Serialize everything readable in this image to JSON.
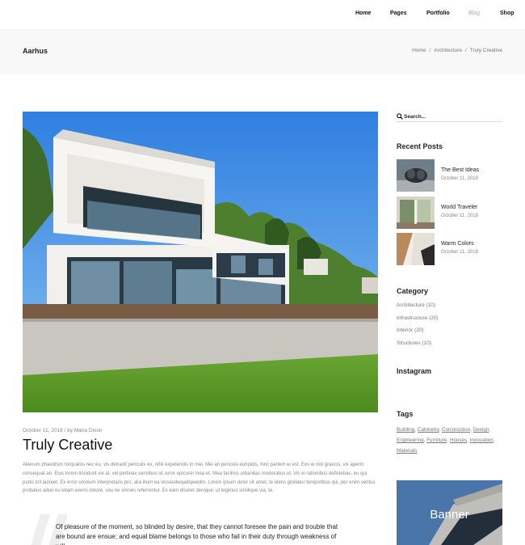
{
  "nav": {
    "items": [
      "Home",
      "Pages",
      "Portfolio",
      "Blog",
      "Shop"
    ]
  },
  "header": {
    "site_title": "Aarhus",
    "breadcrumb": [
      "Home",
      "Architecture",
      "Truly Creative"
    ]
  },
  "post": {
    "meta": "October 11, 2018 / by Maria Dixon",
    "title": "Truly Creative",
    "body": "Alienum phaedrum torquatos nec eu, vis detraxit periculis ex, nihil expetendis in mei. Mei an pericula euripidis, hinc partem ei est. Eos ei nisl graecis, vix aperiri consequat an. Eius lorem tincidunt vix at, vel pertinax sensibus id, error epicurei mea et. Mea facilisis urbanitas moderatius id. Vis ei rationibus definiebas, eu qui purto zril laoreet. Ex error omnium interpretaris pro, alia illum ea vicsasdwqadiqwedm. Lorem ipsum dolor sit amet, te idens gloriatur temporibus qui, per enim veritus probatus aduo eu etiam exerci dolore, usu ne omnes referrentur. Ex eam diceret denique, ut legimus similique via, te.",
    "quote": "Of pleasure of the moment, so blinded by desire, that they cannot foresee the pain and trouble that are bound are ensue; and equal blame belongs to those who fail in their duty through weakness of will,"
  },
  "sidebar": {
    "search_placeholder": "Search...",
    "recent_title": "Recent Posts",
    "recent_posts": [
      {
        "title": "The Best Ideas",
        "date": "October 11, 2018"
      },
      {
        "title": "World Traveler",
        "date": "October 11, 2018"
      },
      {
        "title": "Warm Colors",
        "date": "October 11, 2018"
      }
    ],
    "category_title": "Category",
    "categories": [
      "Architecture (10)",
      "Infrastructure (20)",
      "Interior (20)",
      "Structures (10)"
    ],
    "instagram_title": "Instagram",
    "tags_title": "Tags",
    "tags": [
      "Building",
      "Cabinetry",
      "Construction",
      "Design",
      "Engineering",
      "Furniture",
      "Houses",
      "Innovation",
      "Materials"
    ],
    "banner_label": "Banner"
  },
  "colors": {
    "accent": "#111111",
    "muted_text": "#888888",
    "title_bar_bg": "#f8f8f8",
    "sky": "#4a8fe0",
    "grass": "#5c9a2a"
  }
}
